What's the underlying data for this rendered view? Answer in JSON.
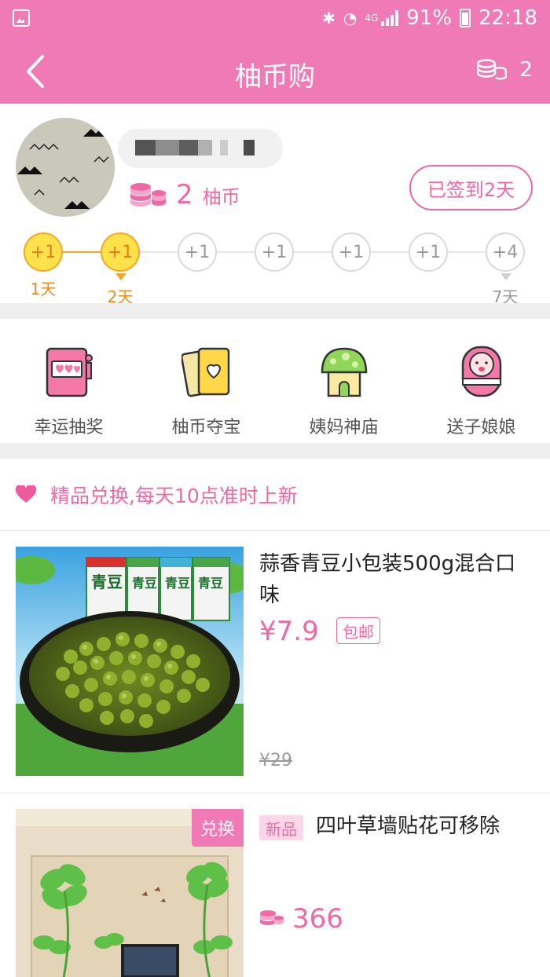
{
  "status_bar": {
    "battery": "91%",
    "time": "22:18",
    "network": "4G"
  },
  "nav": {
    "title": "柚币购",
    "coin_count": "2"
  },
  "profile": {
    "coin_count": "2",
    "coin_unit": "柚币",
    "signin_label": "已签到2天",
    "days": [
      {
        "reward": "+1",
        "label": "1天",
        "done": true
      },
      {
        "reward": "+1",
        "label": "2天",
        "done": true
      },
      {
        "reward": "+1",
        "label": "",
        "done": false
      },
      {
        "reward": "+1",
        "label": "",
        "done": false
      },
      {
        "reward": "+1",
        "label": "",
        "done": false
      },
      {
        "reward": "+1",
        "label": "",
        "done": false
      },
      {
        "reward": "+4",
        "label": "7天",
        "done": false
      }
    ]
  },
  "features": [
    {
      "label": "幸运抽奖",
      "icon": "slot-machine-icon"
    },
    {
      "label": "柚币夺宝",
      "icon": "cards-icon"
    },
    {
      "label": "姨妈神庙",
      "icon": "temple-icon"
    },
    {
      "label": "送子娘娘",
      "icon": "baby-icon"
    }
  ],
  "banner": {
    "text": "精品兑换,每天10点准时上新"
  },
  "products": [
    {
      "title": "蒜香青豆小包装500g混合口味",
      "price": "¥7.9",
      "tag": "包邮",
      "original_price": "¥29",
      "image_text": [
        "青豆",
        "青豆",
        "青豆",
        "青豆"
      ]
    },
    {
      "badge": "兑换",
      "new_tag": "新品",
      "title": "四叶草墙贴花可移除",
      "coin_price": "366"
    }
  ],
  "colors": {
    "brand_pink": "#f07ab5",
    "accent_pink": "#ee6aa7",
    "gold": "#f5a623"
  }
}
